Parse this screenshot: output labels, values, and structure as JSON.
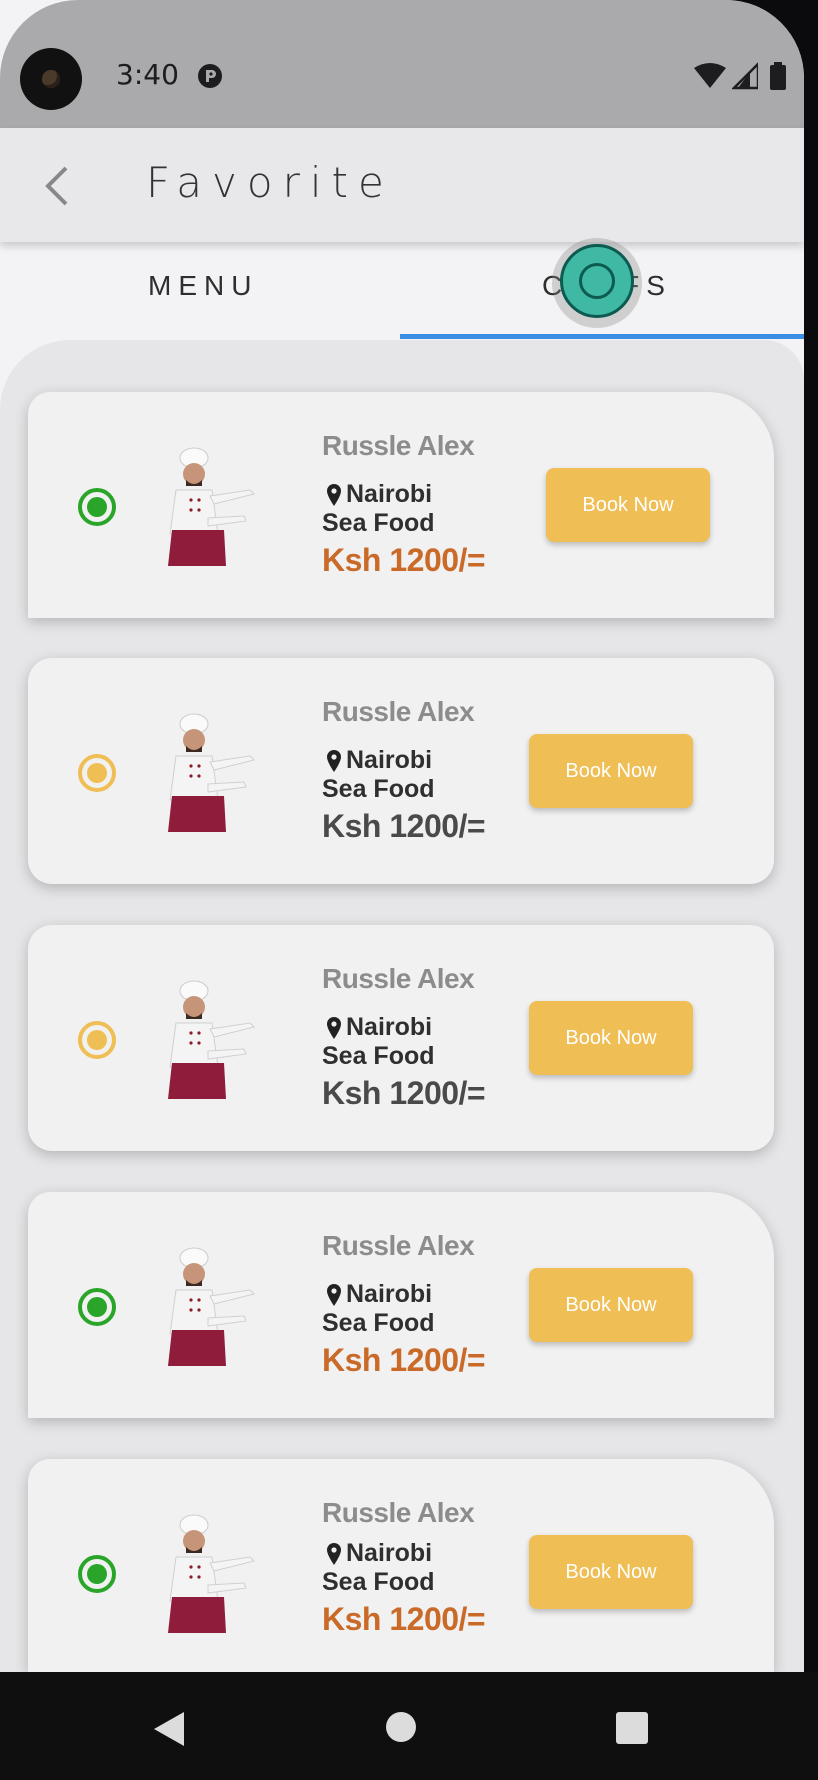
{
  "status_bar": {
    "time": "3:40",
    "icons": [
      "sync-icon",
      "wifi-icon",
      "cell-signal-icon",
      "battery-icon"
    ]
  },
  "app_bar": {
    "title": "Favorite",
    "back_icon": "chevron-left-icon"
  },
  "tabs": [
    {
      "label": "MENU",
      "active": false
    },
    {
      "label": "CHEFS",
      "active": true
    }
  ],
  "colors": {
    "accent_blue": "#3a8ee6",
    "button_yellow": "#efbe55",
    "radio_green": "#2aa52a",
    "radio_yellow": "#efbe55",
    "price_orange": "#c96a28",
    "price_dark": "#4a4a4a"
  },
  "chefs": [
    {
      "name": "Russle Alex",
      "location": "Nairobi",
      "cuisine": "Sea Food",
      "price": "Ksh 1200/=",
      "status": "green",
      "button": "Book Now"
    },
    {
      "name": "Russle Alex",
      "location": "Nairobi",
      "cuisine": "Sea Food",
      "price": "Ksh 1200/=",
      "status": "yellow",
      "button": "Book Now"
    },
    {
      "name": "Russle Alex",
      "location": "Nairobi",
      "cuisine": "Sea Food",
      "price": "Ksh 1200/=",
      "status": "yellow",
      "button": "Book Now"
    },
    {
      "name": "Russle Alex",
      "location": "Nairobi",
      "cuisine": "Sea Food",
      "price": "Ksh 1200/=",
      "status": "green",
      "button": "Book Now"
    },
    {
      "name": "Russle Alex",
      "location": "Nairobi",
      "cuisine": "Sea Food",
      "price": "Ksh 1200/=",
      "status": "green",
      "button": "Book Now"
    }
  ],
  "nav_bar": {
    "icons": [
      "back-triangle-icon",
      "home-circle-icon",
      "recents-square-icon"
    ]
  }
}
